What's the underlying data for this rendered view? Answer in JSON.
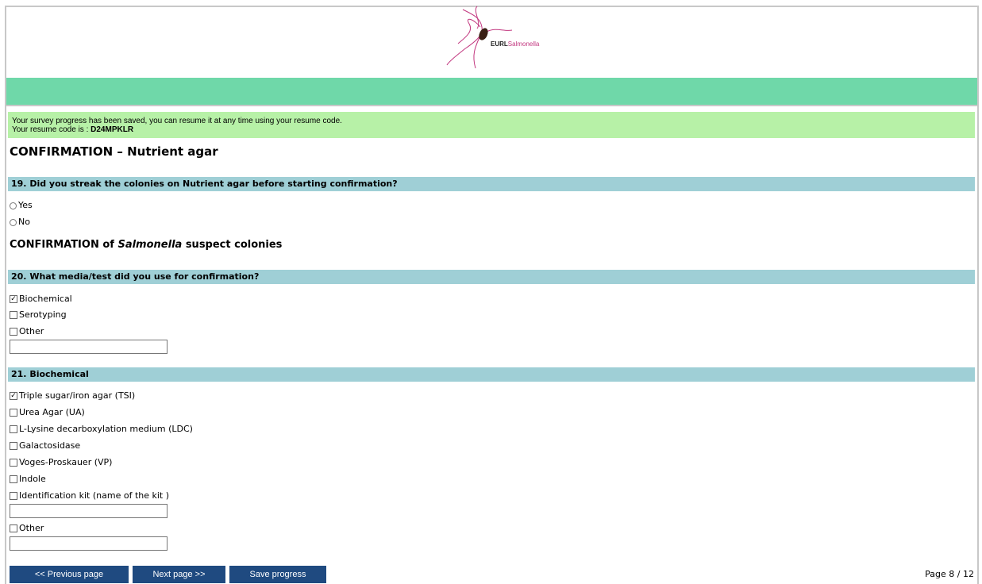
{
  "header": {
    "logo_bold": "EURL",
    "logo_pink": "Salmonella"
  },
  "notice": {
    "line1": "Your survey progress has been saved, you can resume it at any time using your resume code.",
    "line2_prefix": "Your resume code is : ",
    "code": "D24MPKLR"
  },
  "section1_title": "CONFIRMATION – Nutrient agar",
  "q19": {
    "label": "19. Did you streak the colonies on Nutrient agar before starting confirmation?",
    "options": [
      "Yes",
      "No"
    ]
  },
  "section2_title": {
    "prefix": "CONFIRMATION of ",
    "italic": "Salmonella",
    "suffix": " suspect colonies"
  },
  "q20": {
    "label": "20. What media/test did you use for confirmation?",
    "options": [
      {
        "label": "Biochemical",
        "checked": true
      },
      {
        "label": "Serotyping",
        "checked": false
      },
      {
        "label": "Other",
        "checked": false
      }
    ],
    "other_value": ""
  },
  "q21": {
    "label": "21. Biochemical",
    "options": [
      {
        "label": "Triple sugar/iron agar (TSI)",
        "checked": true
      },
      {
        "label": "Urea Agar (UA)",
        "checked": false
      },
      {
        "label": "L-Lysine decarboxylation medium (LDC)",
        "checked": false
      },
      {
        "label": "Galactosidase",
        "checked": false
      },
      {
        "label": "Voges-Proskauer (VP)",
        "checked": false
      },
      {
        "label": "Indole",
        "checked": false
      },
      {
        "label": "Identification kit (name of the kit )",
        "checked": false
      },
      {
        "label": "Other",
        "checked": false
      }
    ],
    "kit_value": "",
    "other_value": ""
  },
  "footer": {
    "prev_label": "<< Previous page",
    "next_label": "Next page >>",
    "save_label": "Save progress",
    "page_indicator": "Page 8 / 12"
  }
}
